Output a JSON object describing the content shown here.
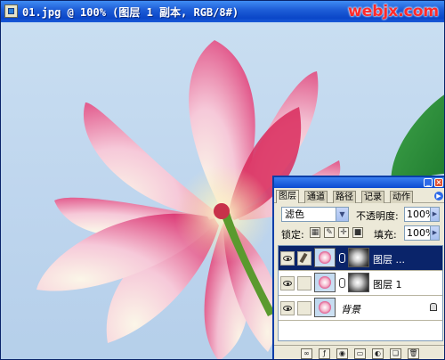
{
  "window": {
    "title": "01.jpg @ 100% (图层 1 副本, RGB/8#)",
    "watermark": "webjx.com"
  },
  "layers_panel": {
    "tabs": [
      {
        "label": "图层",
        "active": true
      },
      {
        "label": "通道",
        "active": false
      },
      {
        "label": "路径",
        "active": false
      },
      {
        "label": "记录",
        "active": false
      },
      {
        "label": "动作",
        "active": false
      }
    ],
    "blend_mode": "滤色",
    "opacity_label": "不透明度:",
    "opacity_value": "100%",
    "lock_label": "锁定:",
    "fill_label": "填充:",
    "fill_value": "100%",
    "layers": [
      {
        "name": "图层 ...",
        "selected": true
      },
      {
        "name": "图层 1",
        "selected": false
      },
      {
        "name": "背景",
        "selected": false
      }
    ]
  },
  "colors": {
    "titlebar": "#0a46c8",
    "watermark": "#ff2a2a",
    "selection": "#0a246a",
    "sky": "#c2d8ef",
    "petal": "#e0457e"
  },
  "icons": {
    "panel_bottom": [
      "link-icon",
      "layer-style-icon",
      "mask-icon",
      "folder-icon",
      "adjustment-icon",
      "new-layer-icon",
      "trash-icon"
    ]
  }
}
